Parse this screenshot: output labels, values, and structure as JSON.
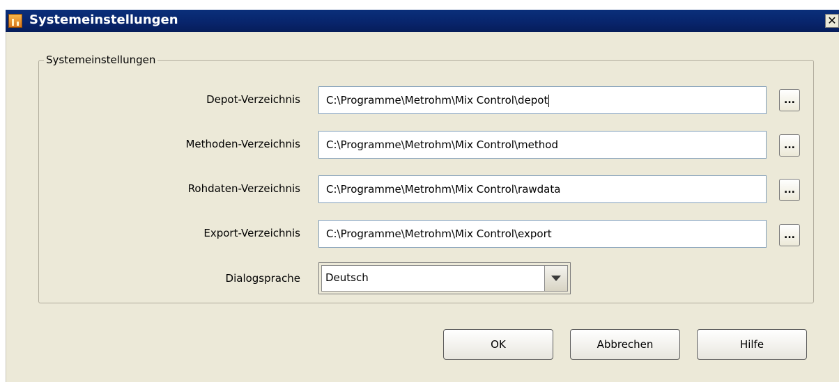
{
  "window": {
    "title": "Systemeinstellungen",
    "close_glyph": "✕"
  },
  "group": {
    "title": "Systemeinstellungen"
  },
  "fields": [
    {
      "label": "Depot-Verzeichnis",
      "value": "C:\\Programme\\Metrohm\\Mix Control\\depot",
      "browse_label": "..."
    },
    {
      "label": "Methoden-Verzeichnis",
      "value": "C:\\Programme\\Metrohm\\Mix Control\\method",
      "browse_label": "..."
    },
    {
      "label": "Rohdaten-Verzeichnis",
      "value": "C:\\Programme\\Metrohm\\Mix Control\\rawdata",
      "browse_label": "..."
    },
    {
      "label": "Export-Verzeichnis",
      "value": "C:\\Programme\\Metrohm\\Mix Control\\export",
      "browse_label": "..."
    }
  ],
  "language": {
    "label": "Dialogsprache",
    "selected": "Deutsch"
  },
  "buttons": {
    "ok": "OK",
    "cancel": "Abbrechen",
    "help": "Hilfe"
  }
}
